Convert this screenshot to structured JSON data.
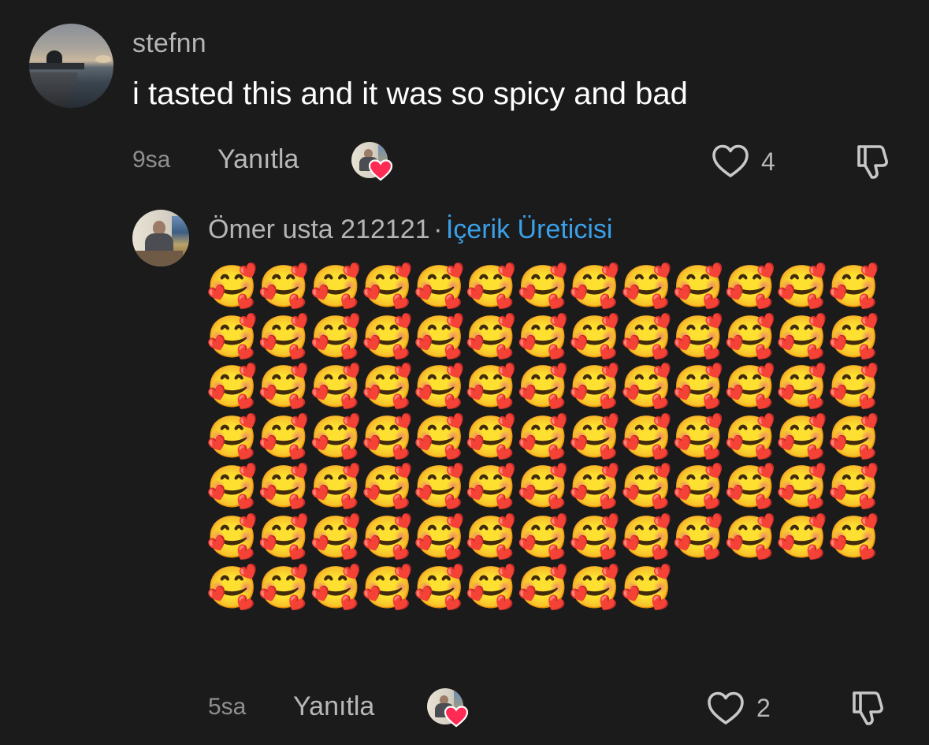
{
  "comment": {
    "username": "stefnn",
    "text": "i tasted this and it was so spicy and bad",
    "time": "9sa",
    "reply_label": "Yanıtla",
    "like_count": "4"
  },
  "reply": {
    "author": "Ömer usta 212121",
    "separator": "·",
    "badge": "İçerik Üreticisi",
    "text": "🥰🥰🥰🥰🥰🥰🥰🥰🥰🥰🥰🥰🥰🥰🥰🥰🥰🥰🥰🥰🥰🥰🥰🥰🥰🥰🥰🥰🥰🥰🥰🥰🥰🥰🥰🥰🥰🥰🥰🥰🥰🥰🥰🥰🥰🥰🥰🥰🥰🥰🥰🥰🥰🥰🥰🥰🥰🥰🥰🥰🥰🥰🥰🥰🥰🥰🥰🥰🥰🥰🥰🥰🥰🥰🥰🥰🥰🥰🥰🥰🥰🥰🥰🥰🥰🥰🥰",
    "time": "5sa",
    "reply_label": "Yanıtla",
    "like_count": "2"
  },
  "icons": {
    "like": "heart-outline-icon",
    "dislike": "thumbs-down-outline-icon",
    "creator_liked": "heart-filled-icon"
  },
  "colors": {
    "background": "#1b1b1b",
    "badge": "#3aa0e8",
    "heart": "#fe2c55"
  }
}
